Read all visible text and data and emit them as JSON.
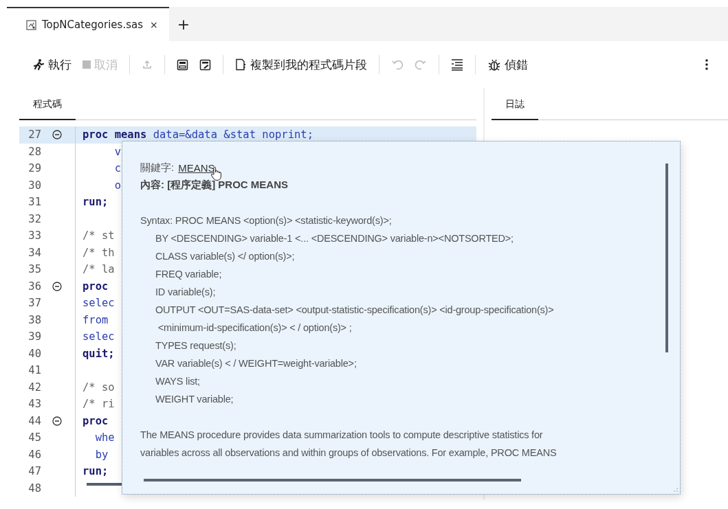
{
  "file_tab": {
    "label": "TopNCategories.sas",
    "close": "×",
    "selected": true
  },
  "new_tab": "+",
  "toolbar": {
    "run": {
      "label": "執行",
      "disabled": false
    },
    "cancel": {
      "label": "取消",
      "disabled": true
    },
    "upload": {
      "disabled": true
    },
    "copy": {
      "label": "複製到我的程式碼片段",
      "disabled": false
    },
    "undo": {
      "disabled": true
    },
    "redo": {
      "disabled": true
    },
    "debug": {
      "label": "偵錯",
      "disabled": false
    }
  },
  "code_panel": {
    "tab": {
      "label": "程式碼",
      "selected": true
    }
  },
  "log_panel": {
    "tab": {
      "label": "日誌",
      "selected": true
    }
  },
  "code_lines": [
    {
      "number": "27",
      "fold": true,
      "highlighted": true,
      "tokens": [
        {
          "text": "proc ",
          "kind": "keyword"
        },
        {
          "text": "means",
          "kind": "keyword"
        },
        {
          "text": " data=&data &stat noprint;",
          "kind": "option"
        }
      ]
    },
    {
      "number": "28",
      "fold": false,
      "highlighted": false,
      "tokens": [
        {
          "text": "     v",
          "kind": "option"
        }
      ]
    },
    {
      "number": "29",
      "fold": false,
      "highlighted": false,
      "tokens": [
        {
          "text": "     c",
          "kind": "option"
        }
      ]
    },
    {
      "number": "30",
      "fold": false,
      "highlighted": false,
      "tokens": [
        {
          "text": "     o",
          "kind": "option"
        }
      ]
    },
    {
      "number": "31",
      "fold": false,
      "highlighted": false,
      "tokens": [
        {
          "text": "run;",
          "kind": "keyword"
        }
      ]
    },
    {
      "number": "32",
      "fold": false,
      "highlighted": false
    },
    {
      "number": "33",
      "fold": false,
      "highlighted": false,
      "tokens": [
        {
          "text": "/* st",
          "kind": "comment"
        }
      ]
    },
    {
      "number": "34",
      "fold": false,
      "highlighted": false,
      "tokens": [
        {
          "text": "/* th",
          "kind": "comment"
        }
      ]
    },
    {
      "number": "35",
      "fold": false,
      "highlighted": false,
      "tokens": [
        {
          "text": "/* la",
          "kind": "comment"
        }
      ]
    },
    {
      "number": "36",
      "fold": true,
      "highlighted": false,
      "tokens": [
        {
          "text": "proc",
          "kind": "keyword"
        }
      ]
    },
    {
      "number": "37",
      "fold": false,
      "highlighted": false,
      "tokens": [
        {
          "text": "selec",
          "kind": "option"
        }
      ]
    },
    {
      "number": "38",
      "fold": false,
      "highlighted": false,
      "tokens": [
        {
          "text": "from",
          "kind": "option"
        }
      ]
    },
    {
      "number": "39",
      "fold": false,
      "highlighted": false,
      "tokens": [
        {
          "text": "selec",
          "kind": "option"
        }
      ]
    },
    {
      "number": "40",
      "fold": false,
      "highlighted": false,
      "tokens": [
        {
          "text": "quit;",
          "kind": "keyword"
        }
      ]
    },
    {
      "number": "41",
      "fold": false,
      "highlighted": false
    },
    {
      "number": "42",
      "fold": false,
      "highlighted": false,
      "tokens": [
        {
          "text": "/* so",
          "kind": "comment"
        }
      ]
    },
    {
      "number": "43",
      "fold": false,
      "highlighted": false,
      "tokens": [
        {
          "text": "/* ri",
          "kind": "comment"
        }
      ]
    },
    {
      "number": "44",
      "fold": true,
      "highlighted": false,
      "tokens": [
        {
          "text": "proc",
          "kind": "keyword"
        }
      ]
    },
    {
      "number": "45",
      "fold": false,
      "highlighted": false,
      "tokens": [
        {
          "text": "  whe",
          "kind": "option"
        }
      ]
    },
    {
      "number": "46",
      "fold": false,
      "highlighted": false,
      "tokens": [
        {
          "text": "  by",
          "kind": "option"
        }
      ]
    },
    {
      "number": "47",
      "fold": false,
      "highlighted": false,
      "tokens": [
        {
          "text": "run;",
          "kind": "keyword"
        }
      ]
    },
    {
      "number": "48",
      "fold": false,
      "highlighted": false
    }
  ],
  "tooltip": {
    "keyword_label": "關鍵字:",
    "keyword": "MEANS",
    "context": "內容: [程序定義] PROC MEANS",
    "syntax": [
      {
        "text": "Syntax: PROC MEANS <option(s)> <statistic-keyword(s)>;",
        "indent": false
      },
      {
        "text": "BY <DESCENDING> variable-1 <... <DESCENDING> variable-n><NOTSORTED>;",
        "indent": true
      },
      {
        "text": "CLASS variable(s) </ option(s)>;",
        "indent": true
      },
      {
        "text": "FREQ variable;",
        "indent": true
      },
      {
        "text": "ID variable(s);",
        "indent": true
      },
      {
        "text": "OUTPUT <OUT=SAS-data-set> <output-statistic-specification(s)> <id-group-specification(s)>",
        "indent": true
      },
      {
        "text": " <minimum-id-specification(s)> < / option(s)> ;",
        "indent": true
      },
      {
        "text": "TYPES request(s);",
        "indent": true
      },
      {
        "text": "VAR variable(s) < / WEIGHT=weight-variable>;",
        "indent": true
      },
      {
        "text": "WAYS list;",
        "indent": true
      },
      {
        "text": "WEIGHT variable;",
        "indent": true
      }
    ],
    "description": [
      "The MEANS procedure provides data summarization tools to compute descriptive statistics for",
      "variables across all observations and within groups of observations. For example, PROC MEANS"
    ]
  }
}
